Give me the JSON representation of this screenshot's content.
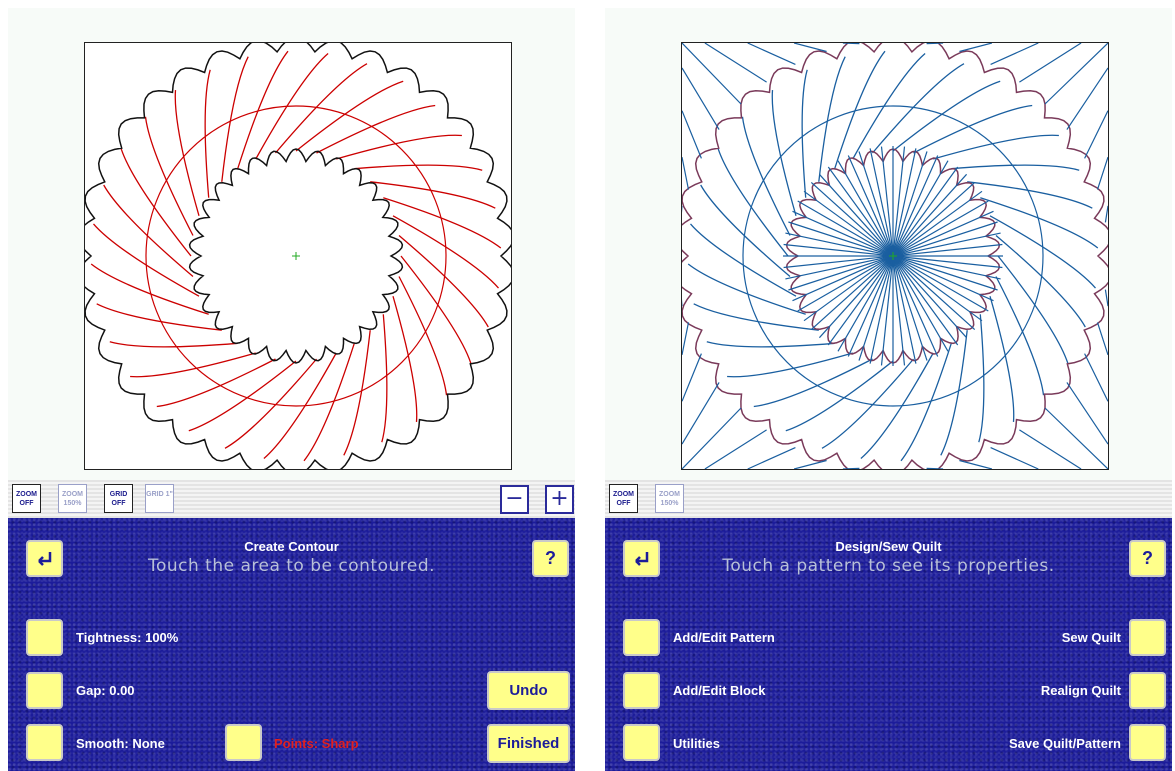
{
  "left": {
    "toolbar": {
      "zoom_off": "ZOOM OFF",
      "zoom_150": "ZOOM 150%",
      "grid_off": "GRID OFF",
      "grid_1": "GRID 1\"",
      "minus": "−",
      "plus": "+"
    },
    "title": "Create Contour",
    "subtitle": "Touch the area to be contoured.",
    "tightness_label": "Tightness: 100%",
    "gap_label": "Gap: 0.00",
    "smooth_label": "Smooth: None",
    "points_label": "Points: Sharp",
    "undo_label": "Undo",
    "finished_label": "Finished",
    "help_label": "?",
    "back_icon": "return-arrow-icon",
    "colors": {
      "contour": "#cc0000",
      "outline": "#111111"
    }
  },
  "right": {
    "toolbar": {
      "zoom_off": "ZOOM OFF",
      "zoom_150": "ZOOM 150%"
    },
    "title": "Design/Sew Quilt",
    "subtitle": "Touch a pattern to see its properties.",
    "add_edit_pattern_label": "Add/Edit Pattern",
    "add_edit_block_label": "Add/Edit Block",
    "utilities_label": "Utilities",
    "sew_quilt_label": "Sew Quilt",
    "realign_quilt_label": "Realign Quilt",
    "save_quilt_label": "Save Quilt/Pattern",
    "help_label": "?",
    "back_icon": "return-arrow-icon",
    "colors": {
      "pattern": "#1a5fa0",
      "outline": "#7a3a5a",
      "center": "#22aa22"
    }
  }
}
